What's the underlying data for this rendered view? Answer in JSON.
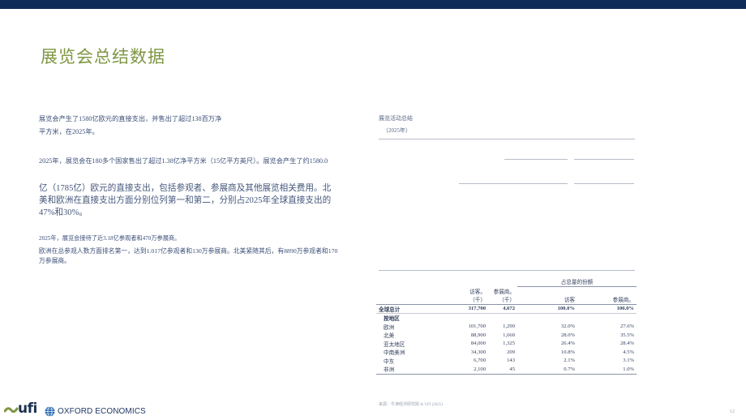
{
  "colors": {
    "top_bar": "#0f2b57",
    "title": "#7f9643",
    "body_text": "#3c4f78"
  },
  "page": {
    "title": "展览会总结数据",
    "page_number": "12"
  },
  "left": {
    "p1": "展览会产生了1580亿欧元的直接支出，并售出了超过138百万净平方米，在2025年。",
    "p2": "2025年，展览会在180多个国家售出了超过1.38亿净平方米（15亿平方英尺）。展览会产生了约1580.0",
    "p3": "亿（1785亿）欧元的直接支出，包括参观者、参展商及其他展览相关费用。北美和欧洲在直接支出方面分别位列第一和第二，分别占2025年全球直接支出的47%和30%。",
    "p4": "2025年，展览会接待了近3.18亿参观者和470万参展商。",
    "p5": "欧洲在总参观人数方面排名第一，达到1.017亿参观者和130万参展商。北美紧随其后，有8890万参观者和170万参展商。"
  },
  "table": {
    "title": "展览活动总结",
    "subtitle": "（2025年）",
    "share_header": "占总量的份额",
    "col_visitors": "访客。",
    "col_visitors_unit": "（千）",
    "col_exhibitors": "参展商。",
    "col_exhibitors_unit": "（千）",
    "col_share_visitors": "访客",
    "col_share_exhibitors": "参展商。",
    "total": {
      "label": "全球总计",
      "visitors": "317,700",
      "exhibitors": "4,672",
      "share_visitors": "100.0%",
      "share_exhibitors": "100.0%"
    },
    "section_label": "按地区",
    "rows": [
      {
        "region": "欧洲",
        "visitors": "101,700",
        "exhibitors": "1,290",
        "share_visitors": "32.0%",
        "share_exhibitors": "27.6%"
      },
      {
        "region": "北美",
        "visitors": "88,900",
        "exhibitors": "1,660",
        "share_visitors": "28.0%",
        "share_exhibitors": "35.5%"
      },
      {
        "region": "亚太地区",
        "visitors": "84,000",
        "exhibitors": "1,325",
        "share_visitors": "26.4%",
        "share_exhibitors": "28.4%"
      },
      {
        "region": "中南美洲",
        "visitors": "34,300",
        "exhibitors": "209",
        "share_visitors": "10.8%",
        "share_exhibitors": "4.5%"
      },
      {
        "region": "中东",
        "visitors": "6,700",
        "exhibitors": "143",
        "share_visitors": "2.1%",
        "share_exhibitors": "3.1%"
      },
      {
        "region": "非洲",
        "visitors": "2,100",
        "exhibitors": "45",
        "share_visitors": "0.7%",
        "share_exhibitors": "1.0%"
      }
    ],
    "source": "来源：牛津经济研究院 & UFI (2025)"
  },
  "logos": {
    "ufi": "ufi",
    "oxford": "OXFORD ECONOMICS"
  }
}
